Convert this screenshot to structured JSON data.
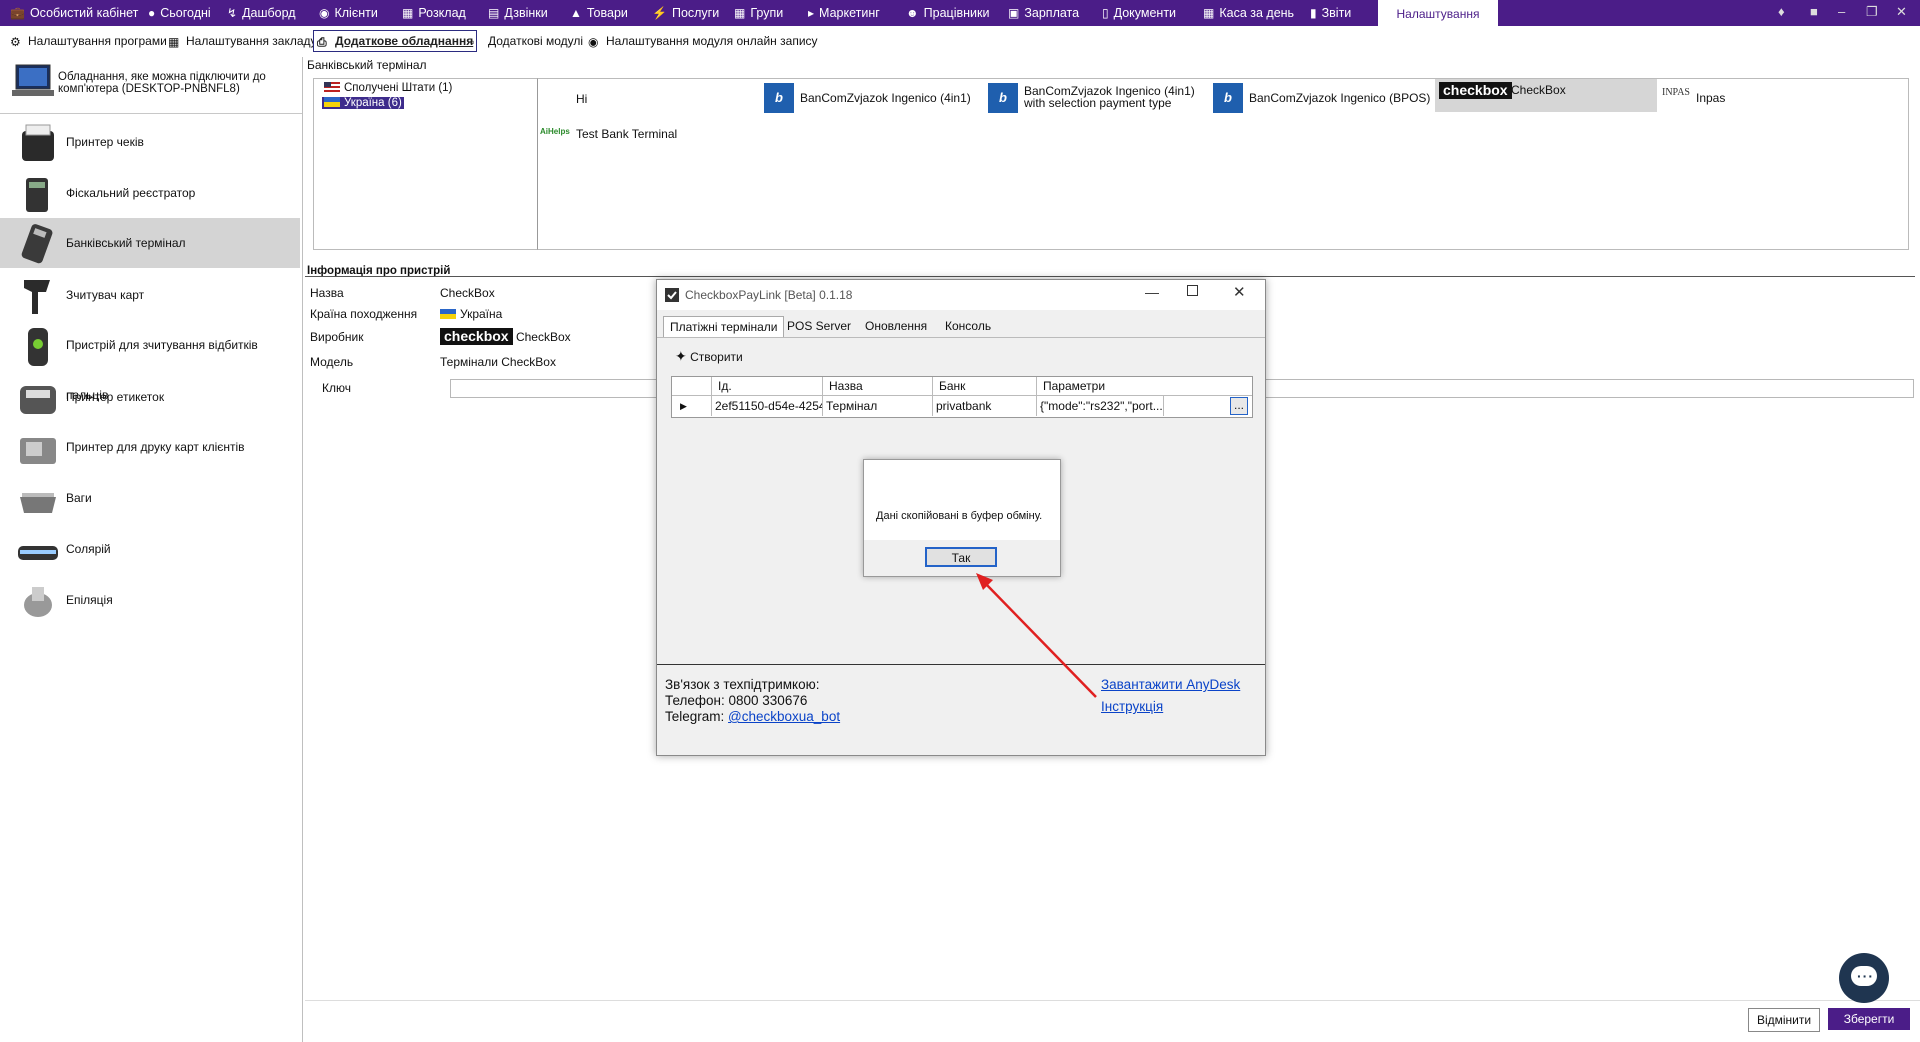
{
  "nav": {
    "items": [
      {
        "label": "Особистий кабінет",
        "icon": "briefcase-icon"
      },
      {
        "label": "Сьогодні",
        "icon": "today-icon"
      },
      {
        "label": "Дашборд",
        "icon": "pulse-icon"
      },
      {
        "label": "Клієнти",
        "icon": "user-circle-icon"
      },
      {
        "label": "Розклад",
        "icon": "calendar-icon"
      },
      {
        "label": "Дзвінки",
        "icon": "phone-book-icon"
      },
      {
        "label": "Товари",
        "icon": "box-icon"
      },
      {
        "label": "Послуги",
        "icon": "lightning-icon"
      },
      {
        "label": "Групи",
        "icon": "group-icon"
      },
      {
        "label": "Маркетинг",
        "icon": "megaphone-icon"
      },
      {
        "label": "Працівники",
        "icon": "person-icon"
      },
      {
        "label": "Зарплата",
        "icon": "money-icon"
      },
      {
        "label": "Документи",
        "icon": "document-icon"
      },
      {
        "label": "Каса за день",
        "icon": "calculator-icon"
      },
      {
        "label": "Звіти",
        "icon": "bar-chart-icon"
      }
    ],
    "active": "Налаштування"
  },
  "subtabs": {
    "items": [
      "Налаштування програми",
      "Налаштування закладу",
      "Додаткове обладнання",
      "Додаткові модулі",
      "Налаштування модуля онлайн запису"
    ]
  },
  "left": {
    "header": "Обладнання, яке можна підключити до комп'ютера (DESKTOP-PNBNFL8)",
    "devices": [
      "Принтер чеків",
      "Фіскальний реєстратор",
      "Банківський термінал",
      "Зчитувач карт",
      "Пристрій для зчитування відбитків пальців",
      "Принтер етикеток",
      "Принтер для друку карт клієнтів",
      "Ваги",
      "Солярій",
      "Епіляція"
    ],
    "selected": "Банківський термінал"
  },
  "main": {
    "section_title": "Банківський термінал",
    "countries": [
      "Сполучені Штати (1)",
      "Україна (6)"
    ],
    "banks": [
      {
        "label": "Hi"
      },
      {
        "label": "BanComZvjazok Ingenico (4in1)",
        "logo": "bkc"
      },
      {
        "label": "BanComZvjazok Ingenico (4in1) with selection payment type",
        "logo": "bkc"
      },
      {
        "label": "BanComZvjazok Ingenico (BPOS)",
        "logo": "bkc"
      },
      {
        "label": "CheckBox",
        "logo": "checkbox"
      },
      {
        "label": "Inpas",
        "logo": "INPAS"
      },
      {
        "label": "Test Bank Terminal",
        "logo": "AiHelps"
      }
    ],
    "info_title": "Інформація про пристрій",
    "info": {
      "name_label": "Назва",
      "name_value": "CheckBox",
      "country_label": "Країна походження",
      "country_value": "Україна",
      "maker_label": "Виробник",
      "maker_value": "CheckBox",
      "maker_logo": "checkbox",
      "model_label": "Модель",
      "model_value": "Термінали CheckBox",
      "key_label": "Ключ"
    },
    "cancel": "Відмінити",
    "save": "Зберегти"
  },
  "window": {
    "title": "CheckboxPayLink [Beta] 0.1.18",
    "tabs": [
      "Платіжні термінали",
      "POS Server",
      "Оновлення",
      "Консоль"
    ],
    "create": "Створити",
    "columns": [
      "Ід.",
      "Назва",
      "Банк",
      "Параметри"
    ],
    "rows": [
      {
        "id": "2ef51150-d54e-4254-a5...",
        "name": "Термінал",
        "bank": "privatbank",
        "params": "{\"mode\":\"rs232\",\"port...",
        "more": "..."
      }
    ],
    "dialog": {
      "message": "Дані скопійовані в буфер обміну.",
      "ok": "Так"
    },
    "support": {
      "line1": "Зв'язок з техпідтримкою:",
      "phone": "Телефон: 0800 330676",
      "telegram_label": "Telegram:",
      "telegram_link": "@checkboxua_bot",
      "anydesk": "Завантажити AnyDesk",
      "manual": "Інструкція"
    }
  },
  "colors": {
    "brand": "#4b1d88",
    "arrow": "#e02020",
    "link": "#0a43c8"
  }
}
